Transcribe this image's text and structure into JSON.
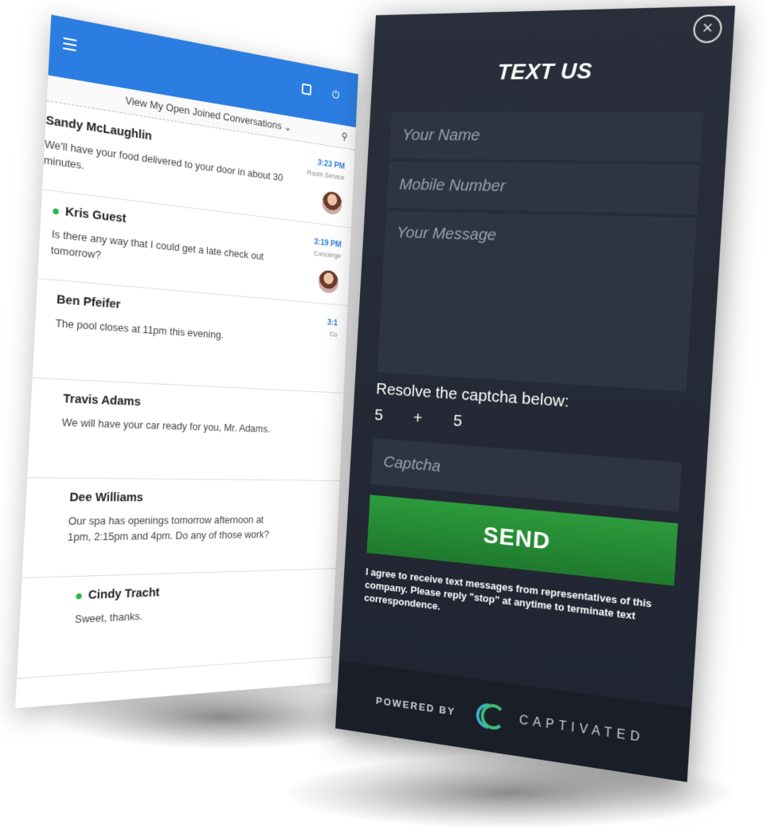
{
  "conversations_header": {
    "filter_label": "View My Open Joined Conversations ⌄"
  },
  "conversations": [
    {
      "name": "Sandy McLaughlin",
      "message": "We'll have your food delivered to your door in about 30 minutes.",
      "time": "3:23 PM",
      "sub": "Room Service",
      "online": false,
      "avatar": true
    },
    {
      "name": "Kris Guest",
      "message": "Is there any way that I could get a late check out tomorrow?",
      "time": "3:19 PM",
      "sub": "Concierge",
      "online": true,
      "avatar": true
    },
    {
      "name": "Ben Pfeifer",
      "message": "The pool closes at 11pm this evening.",
      "time": "3:1",
      "sub": "Co",
      "online": false,
      "avatar": false
    },
    {
      "name": "Travis Adams",
      "message": "We will have your car ready for you, Mr. Adams.",
      "time": "",
      "sub": "",
      "online": false,
      "avatar": false
    },
    {
      "name": "Dee Williams",
      "message": "Our spa has openings tomorrow afternoon at 1pm, 2:15pm and 4pm. Do any of those work?",
      "time": "",
      "sub": "",
      "online": false,
      "avatar": false
    },
    {
      "name": "Cindy Tracht",
      "message": "Sweet, thanks.",
      "time": "",
      "sub": "",
      "online": true,
      "avatar": false
    }
  ],
  "text_us": {
    "title": "TEXT US",
    "name_placeholder": "Your Name",
    "mobile_placeholder": "Mobile Number",
    "message_placeholder": "Your Message",
    "captcha_label": "Resolve the captcha below:",
    "captcha_a": "5",
    "captcha_op": "+",
    "captcha_b": "5",
    "captcha_placeholder": "Captcha",
    "send_label": "SEND",
    "agreement": "I agree to receive text messages from representatives of this company. Please reply \"stop\" at anytime to terminate text correspondence.",
    "powered_by": "POWERED BY",
    "brand": "CAPTIVATED"
  },
  "colors": {
    "header_blue": "#2b7de1",
    "panel_dark": "#252a35",
    "send_green": "#28903a",
    "online_green": "#29b34b"
  }
}
